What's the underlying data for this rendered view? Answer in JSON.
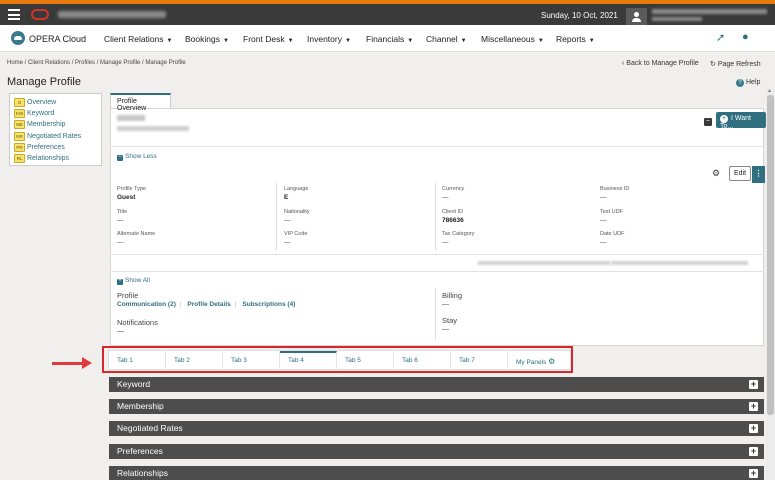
{
  "header": {
    "date": "Sunday, 10 Oct, 2021"
  },
  "nav": {
    "brand": "OPERA Cloud",
    "items": [
      "Client Relations",
      "Bookings",
      "Front Desk",
      "Inventory",
      "Financials",
      "Channel",
      "Miscellaneous",
      "Reports"
    ]
  },
  "breadcrumb": "Home / Client Relations / Profiles / Manage Profile / Manage Profile",
  "top_links": {
    "back": "Back to Manage Profile",
    "refresh": "Page Refresh"
  },
  "page_title": "Manage Profile",
  "help": "Help",
  "left_nav": [
    {
      "badge": "O",
      "label": "Overview"
    },
    {
      "badge": "KW",
      "label": "Keyword"
    },
    {
      "badge": "ME",
      "label": "Membership"
    },
    {
      "badge": "NR",
      "label": "Negotiated Rates"
    },
    {
      "badge": "PR",
      "label": "Preferences"
    },
    {
      "badge": "RL",
      "label": "Relationships"
    }
  ],
  "overview_tab": "Profile Overview",
  "i_want_to": "I Want To...",
  "show_less": "Show Less",
  "edit": "Edit",
  "fields": [
    {
      "label": "Profile Type",
      "value": "Guest"
    },
    {
      "label": "Language",
      "value": "E"
    },
    {
      "label": "Currency",
      "value": "—"
    },
    {
      "label": "Business ID",
      "value": "—"
    },
    {
      "label": "Title",
      "value": "—"
    },
    {
      "label": "Nationality",
      "value": "—"
    },
    {
      "label": "Client ID",
      "value": "786636"
    },
    {
      "label": "Test UDF",
      "value": "—"
    },
    {
      "label": "Alternate Name",
      "value": "—"
    },
    {
      "label": "VIP Code",
      "value": "—"
    },
    {
      "label": "Tax Category",
      "value": "—"
    },
    {
      "label": "Date UDF",
      "value": "—"
    }
  ],
  "show_all": "Show All",
  "profile_section": {
    "title": "Profile",
    "links": [
      "Communication (2)",
      "Profile Details",
      "Subscriptions (4)"
    ],
    "notifications": "Notifications",
    "notifications_value": "—",
    "billing": "Billing",
    "billing_value": "—",
    "stay": "Stay",
    "stay_value": "—"
  },
  "tabs": [
    "Tab 1",
    "Tab 2",
    "Tab 3",
    "Tab 4",
    "Tab 5",
    "Tab 6",
    "Tab 7",
    "My Panels"
  ],
  "active_tab": "Tab 4",
  "panels": [
    "Keyword",
    "Membership",
    "Negotiated Rates",
    "Preferences",
    "Relationships"
  ],
  "colors": {
    "accent": "#2f6f80",
    "topbar": "#3a3a3a",
    "highlight": "#d9262c"
  }
}
